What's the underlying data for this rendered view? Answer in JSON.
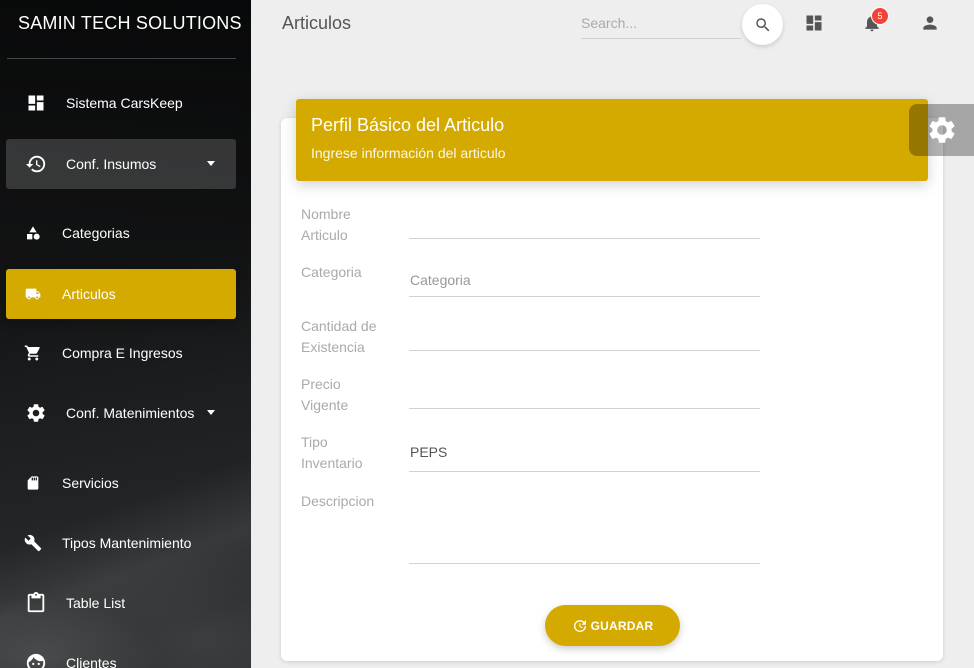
{
  "sidebar": {
    "brand": "SAMIN TECH SOLUTIONS",
    "items": [
      {
        "label": "Sistema CarsKeep",
        "icon": "dashboard-icon"
      },
      {
        "label": "Conf. Insumos",
        "icon": "restore-icon"
      },
      {
        "label": "Categorias",
        "icon": "category-icon"
      },
      {
        "label": "Articulos",
        "icon": "local-shipping-icon"
      },
      {
        "label": "Compra E Ingresos",
        "icon": "shopping-cart-icon"
      },
      {
        "label": "Conf. Matenimientos",
        "icon": "settings-icon"
      },
      {
        "label": "Servicios",
        "icon": "sd-card-icon"
      },
      {
        "label": "Tipos Mantenimiento",
        "icon": "build-icon"
      },
      {
        "label": "Table List",
        "icon": "content-paste-icon"
      },
      {
        "label": "Clientes",
        "icon": "face-icon"
      }
    ]
  },
  "topbar": {
    "title": "Articulos",
    "search_placeholder": "Search...",
    "notification_count": "5"
  },
  "card": {
    "title": "Perfil Básico del Articulo",
    "subtitle": "Ingrese información del articulo"
  },
  "form": {
    "nombre_label": "Nombre Articulo",
    "categoria_label": "Categoria",
    "categoria_placeholder": "Categoria",
    "cantidad_label": "Cantidad de Existencia",
    "precio_label": "Precio Vigente",
    "tipo_label": "Tipo Inventario",
    "tipo_value": "PEPS",
    "descripcion_label": "Descripcion"
  },
  "save_label": "GUARDAR",
  "colors": {
    "accent": "#d4aa00",
    "badge": "#f44336"
  }
}
